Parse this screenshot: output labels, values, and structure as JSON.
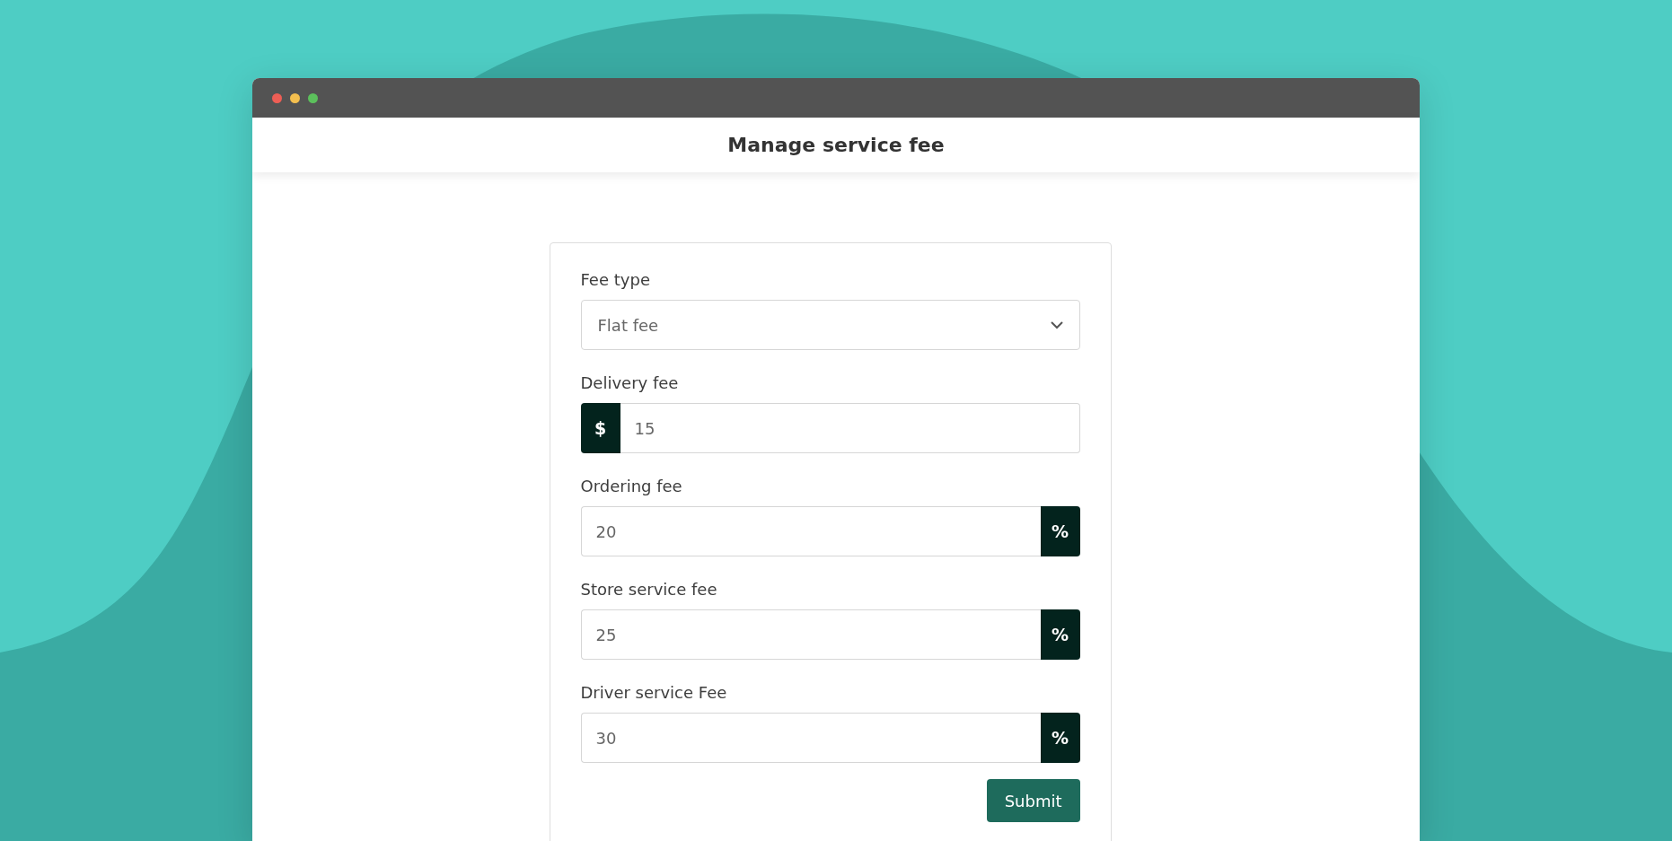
{
  "window": {
    "title": "Manage service fee"
  },
  "form": {
    "fields": [
      {
        "kind": "select",
        "label": "Fee type",
        "value": "Flat fee"
      },
      {
        "kind": "prefix",
        "label": "Delivery fee",
        "addon": "$",
        "value": "15"
      },
      {
        "kind": "suffix",
        "label": "Ordering fee",
        "addon": "%",
        "value": "20"
      },
      {
        "kind": "suffix",
        "label": "Store service fee",
        "addon": "%",
        "value": "25"
      },
      {
        "kind": "suffix",
        "label": "Driver service Fee",
        "addon": "%",
        "value": "30"
      }
    ],
    "submit": "Submit"
  }
}
